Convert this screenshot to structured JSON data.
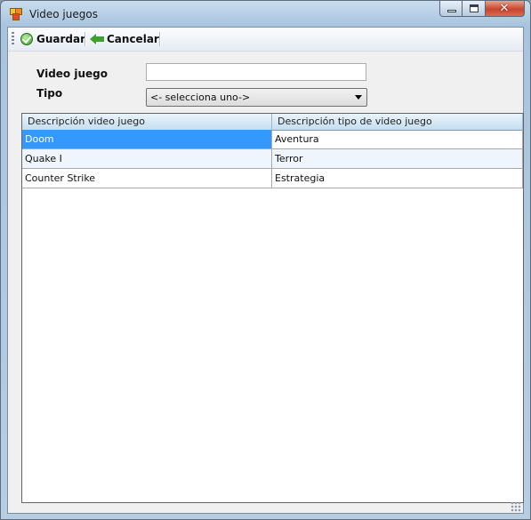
{
  "window": {
    "title": "Video juegos",
    "close_glyph": "✕"
  },
  "toolbar": {
    "save_label": "Guardar",
    "cancel_label": "Cancelar"
  },
  "form": {
    "video_label": "Video juego",
    "video_value": "",
    "tipo_label": "Tipo",
    "tipo_selected": "<- selecciona uno->"
  },
  "grid": {
    "columns": [
      "Descripción video juego",
      "Descripción tipo de video juego"
    ],
    "rows": [
      [
        "Doom",
        "Aventura"
      ],
      [
        "Quake I",
        "Terror"
      ],
      [
        "Counter Strike",
        "Estrategia"
      ]
    ]
  },
  "colors": {
    "selection": "#3399ff",
    "alt_row": "#eef5fc",
    "close_button": "#c8452d"
  }
}
